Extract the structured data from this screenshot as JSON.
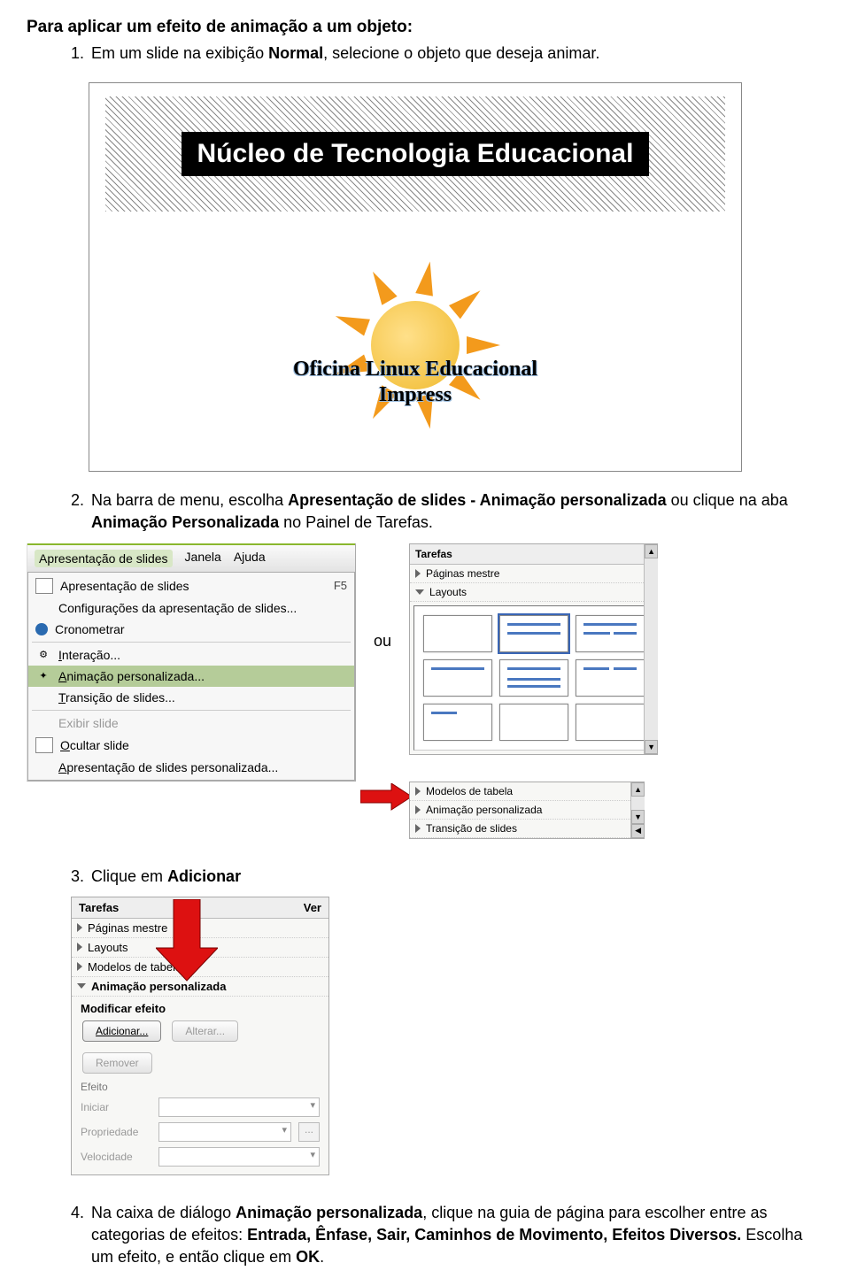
{
  "heading": "Para aplicar um efeito de animação a um objeto:",
  "step1_num": "1.",
  "step1_pre": "Em um slide na exibição ",
  "step1_bold": "Normal",
  "step1_post": ", selecione o objeto que deseja animar.",
  "slide": {
    "banner": "Núcleo de Tecnologia Educacional",
    "line1": "Oficina Linux Educacional",
    "line2": "Impress"
  },
  "step2_num": "2.",
  "step2_a": "Na barra de menu, escolha ",
  "step2_b": "Apresentação de slides - Animação personalizada",
  "step2_c": " ou clique na aba ",
  "step2_d": "Animação Personalizada",
  "step2_e": " no Painel de Tarefas.",
  "ou": "ou",
  "menu": {
    "m1": "Apresentação de slides",
    "m2": "Janela",
    "m3": "Ajuda",
    "i1": "Apresentação de slides",
    "i1s": "F5",
    "i2": "Configurações da apresentação de slides...",
    "i3": "Cronometrar",
    "i4": "Interação...",
    "i5": "Animação personalizada...",
    "i6": "Transição de slides...",
    "i7": "Exibir slide",
    "i8": "Ocultar slide",
    "i9": "Apresentação de slides personalizada..."
  },
  "pane": {
    "title": "Tarefas",
    "r1": "Páginas mestre",
    "r2": "Layouts",
    "r3": "Modelos de tabela",
    "r4": "Animação personalizada",
    "r5": "Transição de slides"
  },
  "step3_num": "3.",
  "step3_a": "Clique em ",
  "step3_b": "Adicionar",
  "pane2": {
    "title": "Tarefas",
    "ver": "Ver",
    "r1": "Páginas mestre",
    "r2": "Layouts",
    "r3": "Modelos de tabela",
    "r4": "Animação personalizada",
    "sect": "Modificar efeito",
    "btn_add": "Adicionar...",
    "btn_alt": "Alterar...",
    "btn_rem": "Remover",
    "efeito": "Efeito",
    "f1": "Iniciar",
    "f2": "Propriedade",
    "f3": "Velocidade",
    "dots": "..."
  },
  "step4_num": "4.",
  "step4_a": "Na caixa de diálogo ",
  "step4_b": "Animação personalizada",
  "step4_c": ", clique na guia de página para escolher entre as categorias de efeitos: ",
  "step4_d": "Entrada, Ênfase, Sair, Caminhos de Movimento, Efeitos Diversos.",
  "step4_e": " Escolha um efeito, e então clique em ",
  "step4_f": "OK",
  "step4_g": "."
}
